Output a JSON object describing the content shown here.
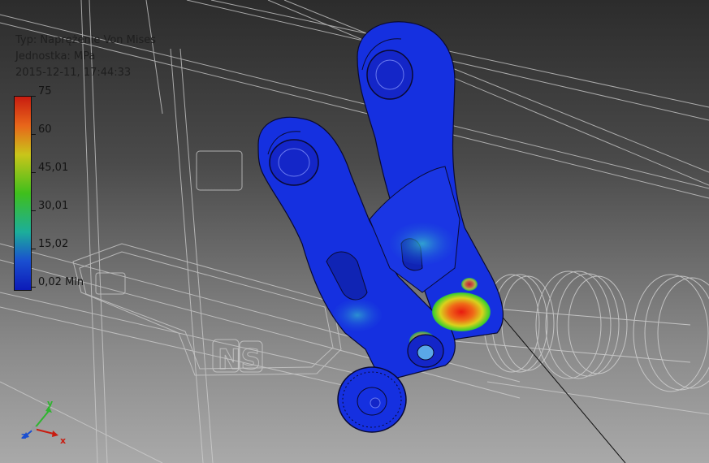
{
  "result_info": {
    "type_label": "Typ: Naprężenie Von Mises",
    "unit_label": "Jednostka: MPa",
    "timestamp": "2015-12-11, 17:44:33"
  },
  "legend": {
    "ticks": [
      "75",
      "60",
      "45,01",
      "30,01",
      "15,02",
      "0,02 Min"
    ],
    "colors": {
      "max": "#c81c10",
      "high": "#e8661a",
      "mid_high": "#c9c51a",
      "mid": "#3fbf1c",
      "mid_low": "#1cae9a",
      "low": "#1a4fd0",
      "min": "#0c1ab8"
    }
  },
  "view_cube_axes": {
    "x": "x",
    "y": "y",
    "z": "z"
  },
  "model": {
    "part_color": "#1530e0",
    "hotspot_color": "#e01c10",
    "wireframe_color": "#d8d8d8",
    "ghost_text": "NS"
  }
}
